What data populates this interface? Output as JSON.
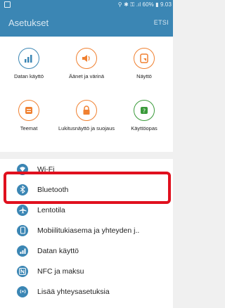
{
  "status_bar": {
    "notification_icon": "screenshot-icon",
    "indicators": "⚲ ✱ ⚿ .ıl 60% ▮ 9.03"
  },
  "header": {
    "title": "Asetukset",
    "search_label": "ETSI",
    "accent_color": "#3b86b4"
  },
  "quick_settings": [
    {
      "label": "Datan käyttö",
      "icon": "bar-chart-icon",
      "color": "#3b86b4"
    },
    {
      "label": "Äänet ja värinä",
      "icon": "speaker-icon",
      "color": "#f08030"
    },
    {
      "label": "Näyttö",
      "icon": "display-icon",
      "color": "#f08030"
    },
    {
      "label": "Teemat",
      "icon": "palette-icon",
      "color": "#f08030"
    },
    {
      "label": "Lukitusnäyttö ja suojaus",
      "icon": "lock-icon",
      "color": "#f08030"
    },
    {
      "label": "Käyttöopas",
      "icon": "help-icon",
      "color": "#3a9a3a"
    }
  ],
  "settings_list": [
    {
      "label": "Wi-Fi",
      "icon": "wifi-icon"
    },
    {
      "label": "Bluetooth",
      "icon": "bluetooth-icon"
    },
    {
      "label": "Lentotila",
      "icon": "airplane-icon"
    },
    {
      "label": "Mobiilitukiasema ja yhteyden j..",
      "icon": "hotspot-icon"
    },
    {
      "label": "Datan käyttö",
      "icon": "data-usage-icon"
    },
    {
      "label": "NFC ja maksu",
      "icon": "nfc-icon"
    },
    {
      "label": "Lisää yhteysasetuksia",
      "icon": "more-connections-icon"
    }
  ],
  "highlight_color": "#e0101e"
}
